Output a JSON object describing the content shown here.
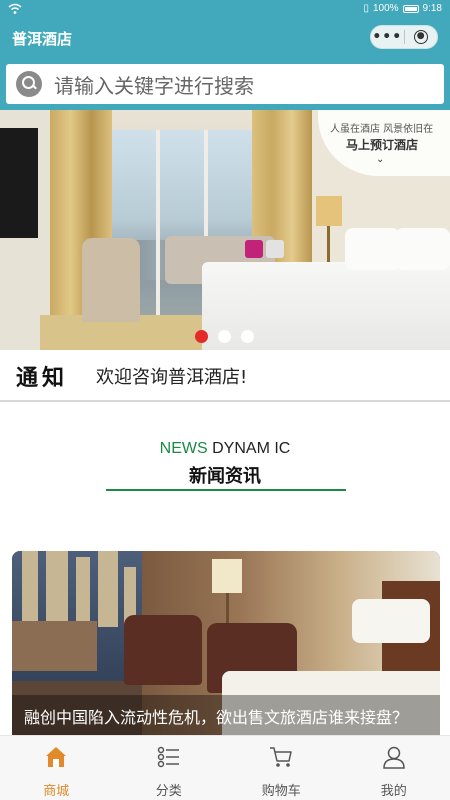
{
  "status_bar": {
    "battery": "100%",
    "time": "9:18"
  },
  "header": {
    "title": "普洱酒店",
    "capsule_more": "•••"
  },
  "search": {
    "placeholder": "请输入关键字进行搜索"
  },
  "banner": {
    "badge_line1": "人虽在酒店  风景依旧在",
    "badge_line2": "马上预订酒店",
    "slide_count": 3,
    "active_slide": 1
  },
  "notice": {
    "tag": "通知",
    "text": "欢迎咨询普洱酒店!"
  },
  "news": {
    "title_en_green": "NEWS",
    "title_en_dark": "DYNAM IC",
    "title_cn": "新闻资讯",
    "items": [
      {
        "title": "融创中国陷入流动性危机，欲出售文旅酒店谁来接盘？"
      }
    ]
  },
  "tab_bar": {
    "items": [
      {
        "label": "商城",
        "icon": "home-icon",
        "active": true
      },
      {
        "label": "分类",
        "icon": "list-icon",
        "active": false
      },
      {
        "label": "购物车",
        "icon": "cart-icon",
        "active": false
      },
      {
        "label": "我的",
        "icon": "user-icon",
        "active": false
      }
    ]
  },
  "colors": {
    "primary": "#41a9bb",
    "accent_green": "#1a8a44",
    "active_tab": "#e08a2b",
    "active_dot": "#e52a2a"
  }
}
